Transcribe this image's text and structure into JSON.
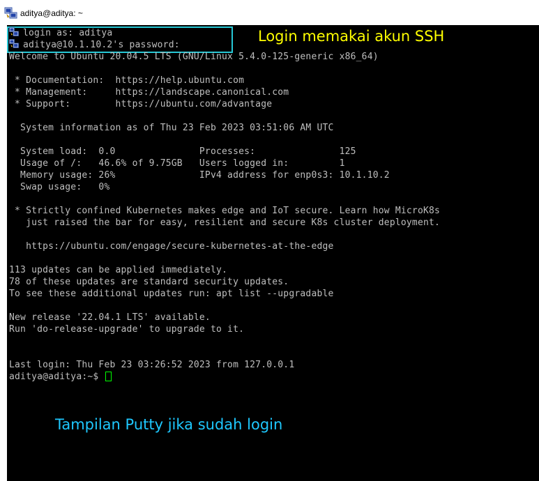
{
  "window": {
    "title": "aditya@aditya: ~",
    "icon": "putty-icon"
  },
  "terminal": {
    "lines": [
      "login as: aditya",
      "aditya@10.1.10.2's password:",
      "Welcome to Ubuntu 20.04.5 LTS (GNU/Linux 5.4.0-125-generic x86_64)",
      "",
      " * Documentation:  https://help.ubuntu.com",
      " * Management:     https://landscape.canonical.com",
      " * Support:        https://ubuntu.com/advantage",
      "",
      "  System information as of Thu 23 Feb 2023 03:51:06 AM UTC",
      "",
      "  System load:  0.0               Processes:               125",
      "  Usage of /:   46.6% of 9.75GB   Users logged in:         1",
      "  Memory usage: 26%               IPv4 address for enp0s3: 10.1.10.2",
      "  Swap usage:   0%",
      "",
      " * Strictly confined Kubernetes makes edge and IoT secure. Learn how MicroK8s",
      "   just raised the bar for easy, resilient and secure K8s cluster deployment.",
      "",
      "   https://ubuntu.com/engage/secure-kubernetes-at-the-edge",
      "",
      "113 updates can be applied immediately.",
      "78 of these updates are standard security updates.",
      "To see these additional updates run: apt list --upgradable",
      "",
      "New release '22.04.1 LTS' available.",
      "Run 'do-release-upgrade' to upgrade to it.",
      "",
      "",
      "Last login: Thu Feb 23 03:26:52 2023 from 127.0.0.1",
      "aditya@aditya:~$ "
    ],
    "colors": {
      "background": "#000000",
      "text": "#bfbfbf",
      "cursor": "#00ff00"
    }
  },
  "annotations": {
    "login_caption": "Login memakai akun SSH",
    "login_caption_color": "#ffff00",
    "putty_caption": "Tampilan Putty jika sudah login",
    "putty_caption_color": "#1ec8ff",
    "box_color": "#27c8d6"
  }
}
